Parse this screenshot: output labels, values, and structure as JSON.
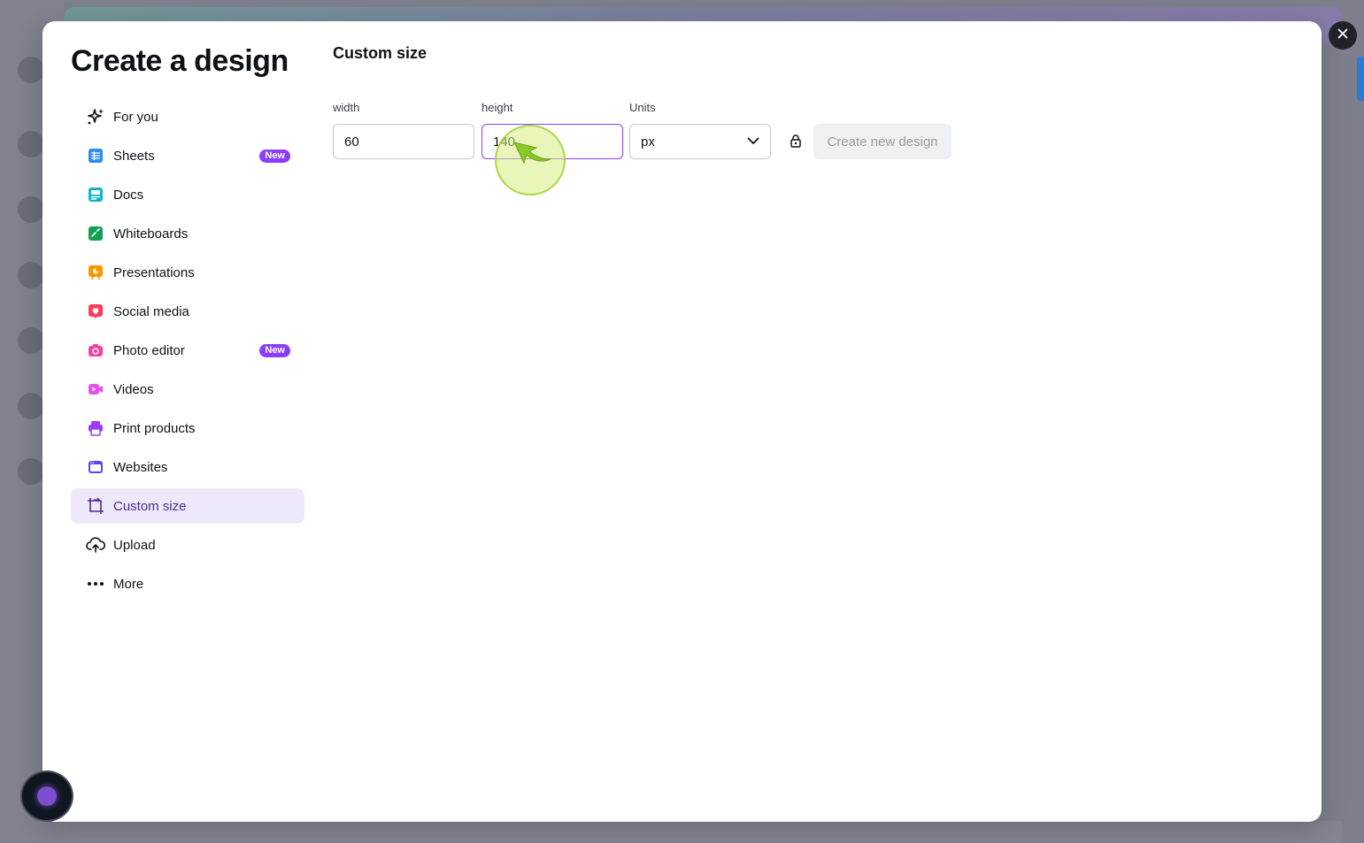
{
  "modal": {
    "title": "Create a design",
    "nav_items": [
      {
        "label": "For you",
        "icon": "sparkle-icon",
        "color": "#0d1216"
      },
      {
        "label": "Sheets",
        "icon": "sheets-icon",
        "color": "#2d8cf0",
        "badge": "New"
      },
      {
        "label": "Docs",
        "icon": "docs-icon",
        "color": "#13b5c9"
      },
      {
        "label": "Whiteboards",
        "icon": "whiteboard-icon",
        "color": "#12a150"
      },
      {
        "label": "Presentations",
        "icon": "presentation-icon",
        "color": "#ff9500"
      },
      {
        "label": "Social media",
        "icon": "heart-icon",
        "color": "#ff3d56"
      },
      {
        "label": "Photo editor",
        "icon": "camera-icon",
        "color": "#ff3d9a",
        "badge": "New"
      },
      {
        "label": "Videos",
        "icon": "video-icon",
        "color": "#e352ed"
      },
      {
        "label": "Print products",
        "icon": "printer-icon",
        "color": "#9b3dff"
      },
      {
        "label": "Websites",
        "icon": "website-icon",
        "color": "#5a45f0"
      },
      {
        "label": "Custom size",
        "icon": "custom-size-icon",
        "color": "#4b2d8c",
        "active": true
      },
      {
        "label": "Upload",
        "icon": "upload-cloud-icon",
        "color": "#0d1216"
      },
      {
        "label": "More",
        "icon": "more-dots-icon",
        "color": "#0d1216"
      }
    ],
    "custom_size": {
      "title": "Custom size",
      "width_label": "width",
      "width_value": "60",
      "height_label": "height",
      "height_value": "140",
      "units_label": "Units",
      "units_value": "px",
      "create_button": "Create new design"
    }
  },
  "colors": {
    "accent": "#8b3dff",
    "active_bg": "#efe8fb"
  }
}
